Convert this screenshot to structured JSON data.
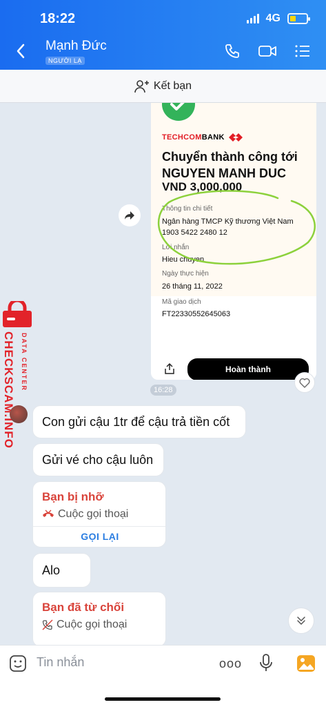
{
  "status_bar": {
    "time": "18:22",
    "network": "4G",
    "battery_level": 0.3
  },
  "header": {
    "contact_name": "Mạnh Đức",
    "stranger_label": "NGƯỜI LẠ"
  },
  "friend_bar": {
    "label": "Kết bạn"
  },
  "receipt": {
    "bank_name_red": "TECHCOM",
    "bank_name_black": "BANK",
    "title": "Chuyển thành công tới NGUYEN MANH DUC",
    "amount": "VND 3,000,000",
    "details_label": "Thông tin chi tiết",
    "bank_full": "Ngân hàng TMCP Kỹ thương Việt Nam",
    "account_number": "1903 5422 2480 12",
    "message_label": "Lời nhắn",
    "message_value": "Hieu chuyen",
    "date_label": "Ngày thực hiện",
    "date_value": "26 tháng 11, 2022",
    "txn_label": "Mã giao dịch",
    "txn_value": "FT22330552645063",
    "done_button": "Hoàn thành"
  },
  "timestamp": "16:28",
  "watermark": {
    "main": "CHECKSCAM.INFO",
    "sub": "DATA CENTER"
  },
  "messages": [
    {
      "text": "Con gửi cậu 1tr để cậu trả tiền cốt"
    },
    {
      "text": "Gửi vé cho cậu luôn"
    },
    {
      "text": "Alo"
    }
  ],
  "calls": [
    {
      "title": "Bạn bị nhỡ",
      "subtitle": "Cuộc gọi thoại",
      "action": "GỌI LẠI"
    },
    {
      "title": "Bạn đã từ chối",
      "subtitle": "Cuộc gọi thoại"
    }
  ],
  "input_bar": {
    "placeholder": "Tin nhắn",
    "more": "ooo"
  },
  "colors": {
    "header_start": "#1a6cf0",
    "header_end": "#2f8ff3",
    "missed_call_red": "#d9443b",
    "callback_blue": "#2a7de1",
    "bank_red": "#e21d25"
  }
}
